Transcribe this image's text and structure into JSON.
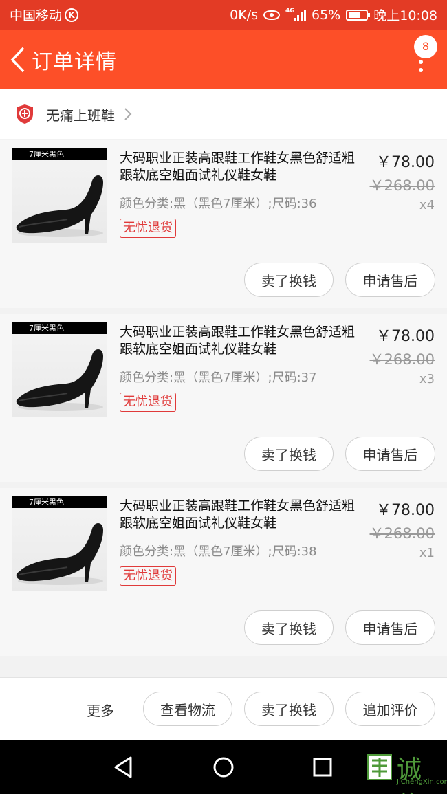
{
  "status_bar": {
    "carrier": "中国移动",
    "carrier_badge": "K",
    "net_speed": "0K/s",
    "network": "4G",
    "battery": "65%",
    "time": "晚上10:08"
  },
  "header": {
    "title": "订单详情",
    "badge_count": "8",
    "icons": [
      "back-arrow-icon",
      "more-vertical-icon"
    ]
  },
  "shop": {
    "name": "无痛上班鞋",
    "icon": "enterprise-shield-icon"
  },
  "items": [
    {
      "image_tag": "7厘米黑色",
      "name": "大码职业正装高跟鞋工作鞋女黑色舒适粗跟软底空姐面试礼仪鞋女鞋",
      "sku": "颜色分类:黑（黑色7厘米）;尺码:36",
      "service_tag": "无忧退货",
      "price": "￥78.00",
      "original_price": "￥268.00",
      "quantity": "x4",
      "buttons": {
        "sell": "卖了换钱",
        "after_sale": "申请售后"
      }
    },
    {
      "image_tag": "7厘米黑色",
      "name": "大码职业正装高跟鞋工作鞋女黑色舒适粗跟软底空姐面试礼仪鞋女鞋",
      "sku": "颜色分类:黑（黑色7厘米）;尺码:37",
      "service_tag": "无忧退货",
      "price": "￥78.00",
      "original_price": "￥268.00",
      "quantity": "x3",
      "buttons": {
        "sell": "卖了换钱",
        "after_sale": "申请售后"
      }
    },
    {
      "image_tag": "7厘米黑色",
      "name": "大码职业正装高跟鞋工作鞋女黑色舒适粗跟软底空姐面试礼仪鞋女鞋",
      "sku": "颜色分类:黑（黑色7厘米）;尺码:38",
      "service_tag": "无忧退货",
      "price": "￥78.00",
      "original_price": "￥268.00",
      "quantity": "x1",
      "buttons": {
        "sell": "卖了换钱",
        "after_sale": "申请售后"
      }
    }
  ],
  "action_bar": {
    "more": "更多",
    "view_logistics": "查看物流",
    "sell": "卖了换钱",
    "add_review": "追加评价"
  },
  "nav_bar": {
    "icons": [
      "back-triangle-icon",
      "home-circle-icon",
      "recents-square-icon"
    ]
  },
  "watermark": {
    "text": "诚信",
    "subtext": "JiChengXin.com"
  },
  "colors": {
    "status_bar": "#e33b25",
    "header": "#fd4f28",
    "accent": "#e03a3a",
    "nav_bar": "#000000"
  }
}
